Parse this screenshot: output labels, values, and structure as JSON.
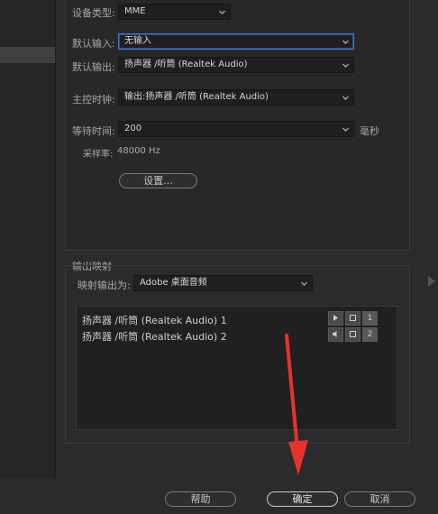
{
  "device": {
    "type_label": "设备类型:",
    "type_value": "MME",
    "default_input_label": "默认输入:",
    "default_input_value": "无输入",
    "default_output_label": "默认输出:",
    "default_output_value": "扬声器 /听筒 (Realtek Audio)",
    "master_clock_label": "主控时钟:",
    "master_clock_value": "输出:扬声器 /听筒 (Realtek Audio)",
    "latency_label": "等待时间:",
    "latency_value": "200",
    "latency_unit": "毫秒",
    "sample_rate_label": "采样率:",
    "sample_rate_value": "48000 Hz",
    "settings_button": "设置..."
  },
  "output_mapping": {
    "section_title": "输出映射",
    "map_to_label": "映射输出为:",
    "map_to_value": "Adobe 桌面音频",
    "rows": [
      {
        "text": "扬声器 /听筒 (Realtek Audio) 1",
        "channel": "1"
      },
      {
        "text": "扬声器 /听筒 (Realtek Audio) 2",
        "channel": "2"
      }
    ]
  },
  "footer": {
    "help": "帮助",
    "ok": "确定",
    "cancel": "取消"
  },
  "colors": {
    "annotation_arrow": "#e8322d",
    "focus_border": "#3f7bd1"
  }
}
